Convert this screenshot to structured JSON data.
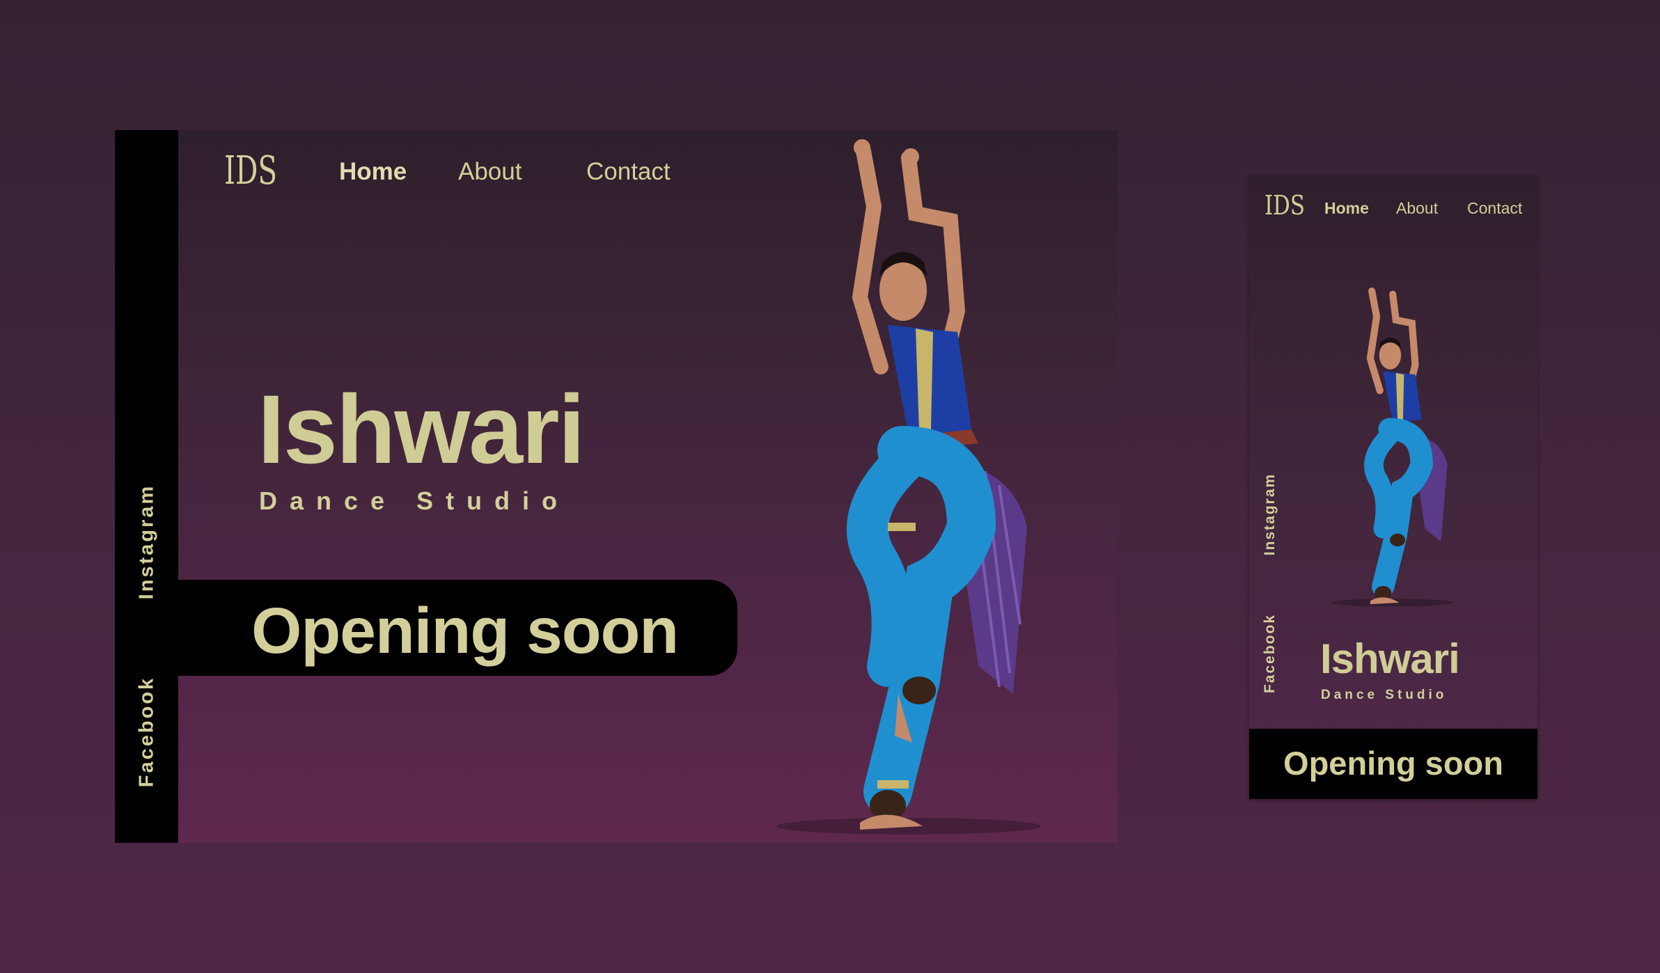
{
  "desktop": {
    "logo_text": "IDS",
    "nav": {
      "home": "Home",
      "about": "About",
      "contact": "Contact"
    },
    "social": {
      "instagram": "Instagram",
      "facebook": "Facebook"
    },
    "hero": {
      "title": "Ishwari",
      "subtitle": "Dance Studio"
    },
    "cta": "Opening soon"
  },
  "mobile": {
    "logo_text": "IDS",
    "nav": {
      "home": "Home",
      "about": "About",
      "contact": "Contact"
    },
    "social": {
      "instagram": "Instagram",
      "facebook": "Facebook"
    },
    "hero": {
      "title": "Ishwari",
      "subtitle": "Dance Studio"
    },
    "cta": "Opening soon"
  },
  "colors": {
    "accent_text": "#d3cf9a",
    "sidebar_bg": "#000000",
    "page_bg": "#45263f",
    "costume_blue": "#1f8fd0",
    "costume_purple": "#5b3a8a"
  }
}
